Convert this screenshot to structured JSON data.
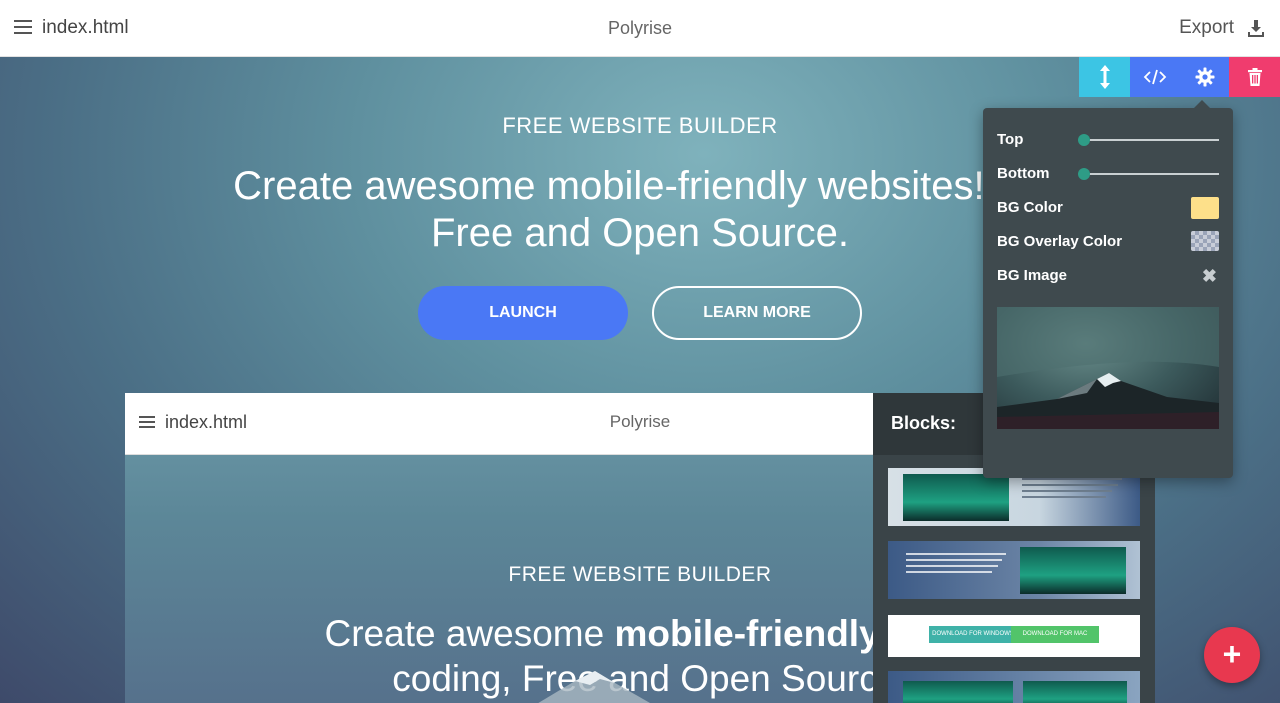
{
  "topbar": {
    "file_name": "index.html",
    "brand": "Polyrise",
    "export_label": "Export"
  },
  "hero": {
    "eyebrow": "FREE WEBSITE BUILDER",
    "headline_line1": "Create awesome mobile-friendly websites! No",
    "headline_line2": "Free and Open Source.",
    "launch_label": "LAUNCH",
    "learn_more_label": "LEARN MORE"
  },
  "preview": {
    "file_name": "index.html",
    "brand": "Polyrise",
    "eyebrow": "FREE WEBSITE BUILDER",
    "headline_part1": "Create awesome ",
    "headline_bold": "mobile-friendly",
    "headline_part2": " wel",
    "headline_line2": "coding, Free and Open Sourc"
  },
  "blocks": {
    "title": "Blocks:",
    "mini_button_windows": "DOWNLOAD FOR WINDOWS",
    "mini_button_mac": "DOWNLOAD FOR MAC"
  },
  "settings": {
    "top_label": "Top",
    "top_value": 0,
    "bottom_label": "Bottom",
    "bottom_value": 0,
    "bg_color_label": "BG Color",
    "bg_color_value": "#fde08a",
    "bg_overlay_label": "BG Overlay Color",
    "bg_image_label": "BG Image"
  },
  "colors": {
    "accent_blue": "#4a78f5",
    "resize_cyan": "#3cc5e4",
    "delete_pink": "#f03c6e",
    "fab_red": "#e8384f",
    "panel_dark": "#3f4a4e"
  }
}
